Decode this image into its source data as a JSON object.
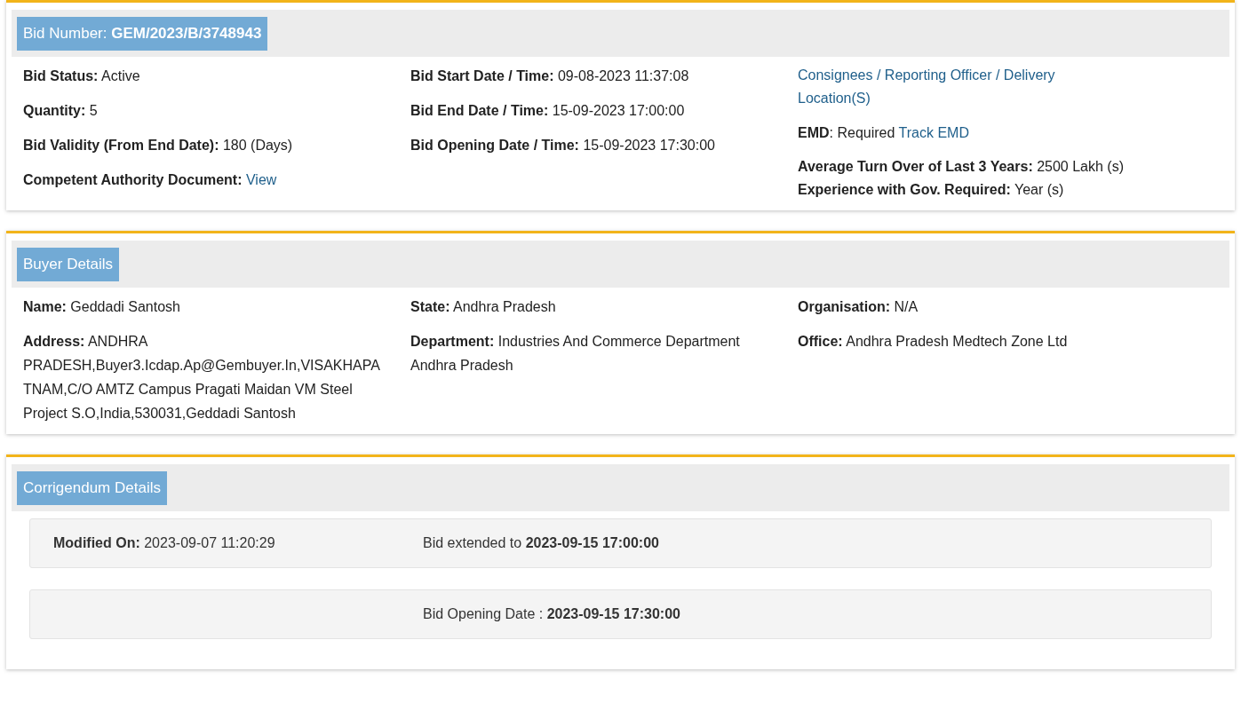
{
  "sections": [
    {
      "title": "Bid Number: **GEM/2023/B/3748943**",
      "kind": "fields",
      "columns": [
        [
          {
            "kind": "text",
            "text": "**Bid Status:** Active"
          },
          {
            "kind": "text",
            "text": "**Quantity:** 5"
          },
          {
            "kind": "text",
            "text": "**Bid Validity (From End Date):** 180 (Days)"
          },
          {
            "kind": "text",
            "text": "**Competent Authority Document:**",
            "link": "View"
          }
        ],
        [
          {
            "kind": "text",
            "text": "**Bid Start Date / Time:** 09-08-2023 11:37:08"
          },
          {
            "kind": "text",
            "text": "**Bid End Date / Time:** 15-09-2023 17:00:00"
          },
          {
            "kind": "text",
            "text": "**Bid Opening Date / Time:** 15-09-2023 17:30:00"
          }
        ],
        [
          {
            "kind": "link",
            "text": "Consignees / Reporting Officer / Delivery Location(S)"
          },
          {
            "kind": "text",
            "text": "**EMD**: Required",
            "link": "Track EMD"
          },
          {
            "kind": "lines",
            "lines": [
              "**Average Turn Over of Last 3 Years:** 2500 Lakh (s)",
              "**Experience with Gov. Required:** Year (s)"
            ]
          }
        ]
      ]
    },
    {
      "title": "Buyer Details",
      "kind": "fields",
      "columns": [
        [
          {
            "kind": "text",
            "text": "**Name:** Geddadi Santosh"
          },
          {
            "kind": "text",
            "text": "**Address:** ANDHRA PRADESH,Buyer3.Icdap.Ap@Gembuyer.In,VISAKHAPATNAM,C/O AMTZ Campus Pragati Maidan VM Steel Project S.O,India,530031,Geddadi Santosh"
          }
        ],
        [
          {
            "kind": "text",
            "text": "**State:** Andhra Pradesh"
          },
          {
            "kind": "text",
            "text": "**Department:** Industries And Commerce Department Andhra Pradesh"
          }
        ],
        [
          {
            "kind": "text",
            "text": "**Organisation:** N/A"
          },
          {
            "kind": "text",
            "text": "**Office:** Andhra Pradesh Medtech Zone Ltd"
          }
        ]
      ]
    },
    {
      "title": "Corrigendum Details",
      "kind": "rows",
      "rows": [
        {
          "left": "**Modified On:** 2023-09-07 11:20:29",
          "right": "Bid extended to **2023-09-15 17:00:00**"
        },
        {
          "right": "Bid Opening Date : **2023-09-15 17:30:00**"
        }
      ]
    }
  ]
}
